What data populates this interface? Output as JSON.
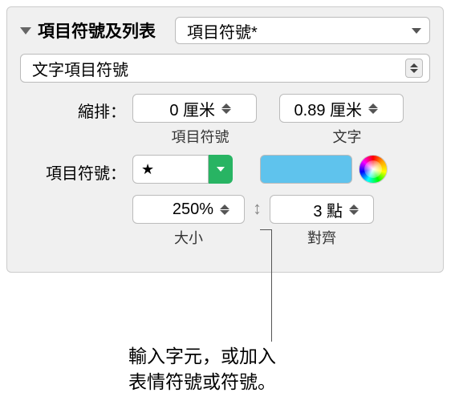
{
  "header": {
    "title": "項目符號及列表",
    "dropdown_value": "項目符號*"
  },
  "sub_dropdown": {
    "value": "文字項目符號"
  },
  "indent": {
    "label": "縮排：",
    "bullet": {
      "value": "0 厘米",
      "sublabel": "項目符號"
    },
    "text": {
      "value": "0.89 厘米",
      "sublabel": "文字"
    }
  },
  "bullet_char": {
    "label": "項目符號：",
    "value": "★"
  },
  "color": {
    "swatch": "#5fc3ed"
  },
  "size": {
    "value": "250%",
    "sublabel": "大小"
  },
  "align": {
    "value": "3 點",
    "sublabel": "對齊"
  },
  "callout": {
    "line1": "輸入字元，或加入",
    "line2": "表情符號或符號。"
  }
}
